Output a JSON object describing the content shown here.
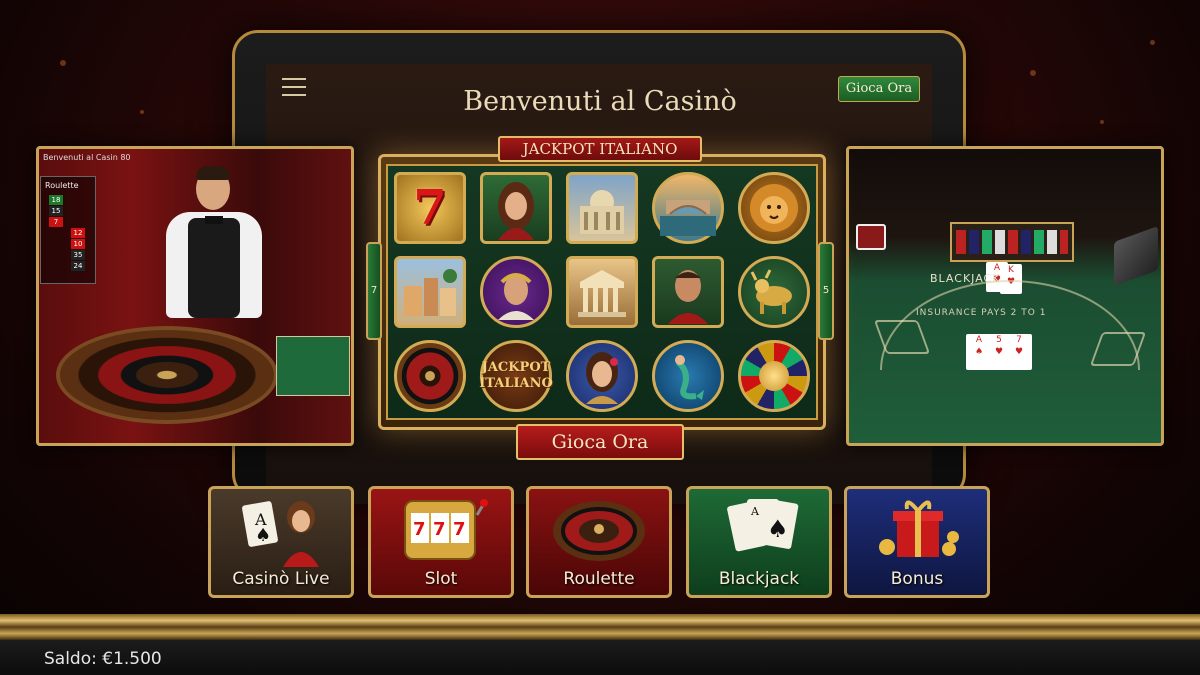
{
  "header": {
    "title": "Benvenuti al Casinò",
    "play_button": "Gioca Ora"
  },
  "live_panel": {
    "top_text": "Benvenuti al Casin 80",
    "list_title": "Roulette",
    "numbers": [
      "18",
      "15",
      "7",
      "12",
      "10",
      "35",
      "24"
    ]
  },
  "slot": {
    "banner": "JACKPOT ITALIANO",
    "left_tab": "7",
    "right_tab": "5",
    "play_button": "Gioca Ora",
    "jackpot_symbol": "JACKPOT ITALIANO",
    "symbols": [
      "seven",
      "italian-woman",
      "basilica",
      "venice-bridge",
      "lion",
      "italian-village",
      "emperor",
      "parthenon",
      "gladiator",
      "golden-bull",
      "roulette-wheel",
      "jackpot-italiano",
      "woman-with-rose",
      "mermaid",
      "wheel-of-fortune"
    ]
  },
  "blackjack_panel": {
    "table_text": "BLACKJACK",
    "table_subtext": "INSURANCE PAYS 2 TO 1"
  },
  "categories": [
    {
      "label": "Casinò Live",
      "icon": "live-dealer-icon"
    },
    {
      "label": "Slot",
      "icon": "slot-machine-icon"
    },
    {
      "label": "Roulette",
      "icon": "roulette-icon"
    },
    {
      "label": "Blackjack",
      "icon": "cards-icon"
    },
    {
      "label": "Bonus",
      "icon": "gift-icon"
    }
  ],
  "status": {
    "balance": "Saldo: €1.500"
  },
  "colors": {
    "gold": "#c9a458",
    "casino_red": "#8a1313",
    "felt_green": "#1f5e3a"
  }
}
